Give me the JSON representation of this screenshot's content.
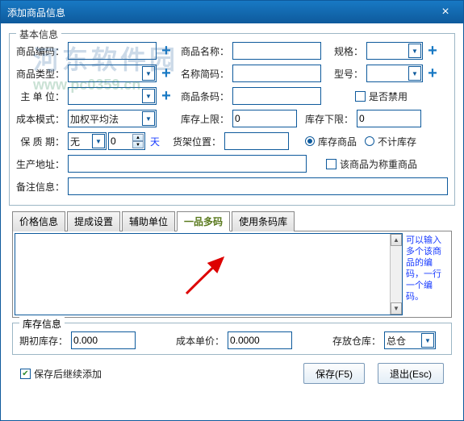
{
  "titlebar": {
    "title": "添加商品信息",
    "close": "×"
  },
  "watermark": {
    "line1": "河东软件园",
    "line2": "www.pc0359.cn"
  },
  "basic": {
    "legend": "基本信息",
    "code_label": "商品编码：",
    "name_label": "商品名称：",
    "spec_label": "规格：",
    "type_label": "商品类型：",
    "abbr_label": "名称简码：",
    "model_label": "型号：",
    "unit_label": "主 单 位：",
    "barcode_label": "商品条码：",
    "disable_label": "是否禁用",
    "cost_mode_label": "成本模式：",
    "cost_mode_value": "加权平均法",
    "stock_upper_label": "库存上限：",
    "stock_upper_value": "0",
    "stock_lower_label": "库存下限：",
    "stock_lower_value": "0",
    "shelf_life_label": "保 质 期：",
    "shelf_life_value": "无",
    "shelf_life_num": "0",
    "shelf_life_unit": "天",
    "shelf_pos_label": "货架位置：",
    "radio_stock": "库存商品",
    "radio_nostock": "不计库存",
    "prod_addr_label": "生产地址：",
    "weigh_label": "该商品为称重商品",
    "remark_label": "备注信息："
  },
  "tabs": {
    "t1": "价格信息",
    "t2": "提成设置",
    "t3": "辅助单位",
    "t4": "一品多码",
    "t5": "使用条码库"
  },
  "hint": "可以输入多个该商品的编码，一行一个编码。",
  "stock": {
    "legend": "库存信息",
    "init_label": "期初库存：",
    "init_value": "0.000",
    "cost_label": "成本单价：",
    "cost_value": "0.0000",
    "warehouse_label": "存放仓库：",
    "warehouse_value": "总仓"
  },
  "bottom": {
    "continue_label": "保存后继续添加",
    "save": "保存(F5)",
    "exit": "退出(Esc)"
  },
  "plus": "+"
}
